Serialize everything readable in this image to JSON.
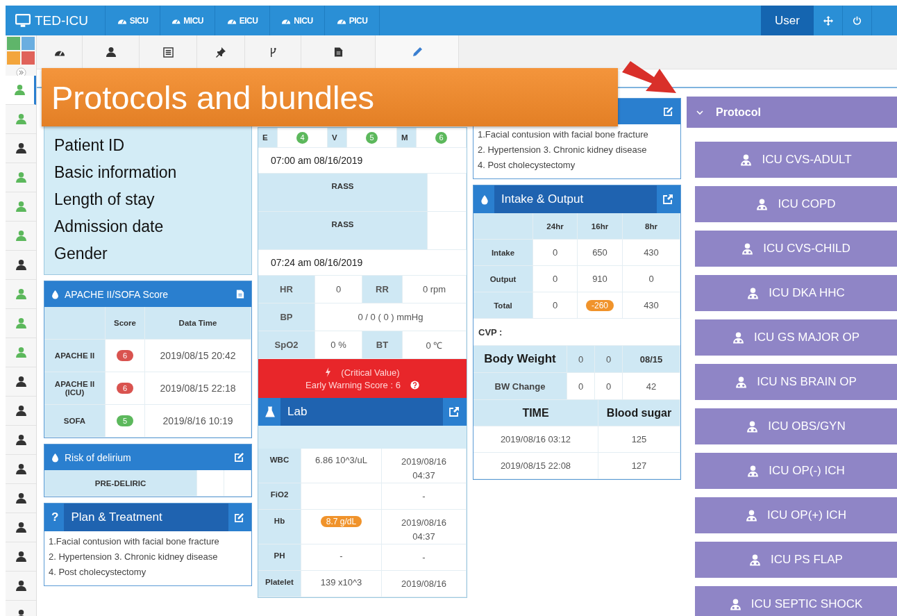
{
  "app": {
    "title": "TED-ICU"
  },
  "units": [
    "SICU",
    "MICU",
    "EICU",
    "NICU",
    "PICU"
  ],
  "user_menu": {
    "label": "User"
  },
  "patients": [
    {
      "color": "#5cb85c",
      "selected": true
    },
    {
      "color": "#5cb85c",
      "selected": false
    },
    {
      "color": "#333333",
      "selected": false
    },
    {
      "color": "#5cb85c",
      "selected": false
    },
    {
      "color": "#5cb85c",
      "selected": false
    },
    {
      "color": "#5cb85c",
      "selected": false
    },
    {
      "color": "#333333",
      "selected": false
    },
    {
      "color": "#5cb85c",
      "selected": false
    },
    {
      "color": "#5cb85c",
      "selected": false
    },
    {
      "color": "#5cb85c",
      "selected": false
    },
    {
      "color": "#333333",
      "selected": false
    },
    {
      "color": "#333333",
      "selected": false
    },
    {
      "color": "#333333",
      "selected": false
    },
    {
      "color": "#333333",
      "selected": false
    },
    {
      "color": "#333333",
      "selected": false
    },
    {
      "color": "#333333",
      "selected": false
    },
    {
      "color": "#333333",
      "selected": false
    },
    {
      "color": "#333333",
      "selected": false
    },
    {
      "color": "#333333",
      "selected": false
    }
  ],
  "banner": {
    "title": "Protocols and bundles"
  },
  "patient_info": {
    "lines": [
      "Patient ID",
      "Basic information",
      "Length of stay",
      "Admission date",
      "Gender"
    ]
  },
  "apache": {
    "title": "APACHE II/SOFA Score",
    "columns": [
      "Score",
      "Data Time"
    ],
    "rows": [
      {
        "name": "APACHE II",
        "score": "6",
        "color": "#d9534f",
        "time": "2019/08/15 20:42"
      },
      {
        "name": "APACHE II (ICU)",
        "score": "6",
        "color": "#d9534f",
        "time": "2019/08/15 22:18"
      },
      {
        "name": "SOFA",
        "score": "5",
        "color": "#5cb85c",
        "time": "2019/8/16 10:19"
      }
    ]
  },
  "delirium": {
    "title": "Risk of delirium",
    "value": "PRE-DELIRIC"
  },
  "plan": {
    "icon": "?",
    "title": "Plan & Treatment",
    "lines": [
      "1.Facial contusion with facial bone fracture",
      "2. Hypertension 3. Chronic kidney disease",
      "4. Post cholecystectomy"
    ]
  },
  "gcs": [
    {
      "label": "E",
      "score": "4"
    },
    {
      "label": "V",
      "score": "5"
    },
    {
      "label": "M",
      "score": "6"
    }
  ],
  "rass": {
    "time": "07:00 am 08/16/2019",
    "rows": [
      "RASS",
      "RASS"
    ]
  },
  "vitals": {
    "time": "07:24 am 08/16/2019",
    "items": [
      {
        "label": "HR",
        "value": "0",
        "wide": false
      },
      {
        "label": "RR",
        "value": "0 rpm",
        "wide": false
      },
      {
        "label": "BP",
        "value": "0 / 0 ( 0 ) mmHg",
        "wide": true
      },
      {
        "label": "SpO2",
        "value": "0 %",
        "wide": false
      },
      {
        "label": "BT",
        "value": "0 ℃",
        "wide": false
      }
    ]
  },
  "warning": {
    "title": "(Critical Value)",
    "text": "Early Warning Score : 6"
  },
  "lab": {
    "title": "Lab",
    "rows": [
      {
        "name": "WBC",
        "value": "6.86 10^3/uL",
        "abnormal": false,
        "time": "2019/08/16 04:37"
      },
      {
        "name": "FiO2",
        "time": "-"
      },
      {
        "name": "Hb",
        "value": "8.7 g/dL",
        "abnormal": true,
        "time": "2019/08/16 04:37"
      },
      {
        "name": "PH",
        "value": "-",
        "abnormal": false,
        "time": "-"
      },
      {
        "name": "Platelet",
        "value": "139 x10^3",
        "abnormal": false,
        "time": "2019/08/16"
      }
    ]
  },
  "diagnosis": {
    "lines": [
      "1.Facial contusion with facial bone fracture",
      "2. Hypertension 3. Chronic kidney disease",
      "4. Post cholecystectomy"
    ]
  },
  "io": {
    "title": "Intake & Output",
    "columns": [
      "24hr",
      "16hr",
      "8hr"
    ],
    "rows": [
      {
        "name": "Intake",
        "values": [
          {
            "text": "0",
            "abnormal": false
          },
          {
            "text": "650",
            "abnormal": false
          },
          {
            "text": "430",
            "abnormal": false
          }
        ]
      },
      {
        "name": "Output",
        "values": [
          {
            "text": "0",
            "abnormal": false
          },
          {
            "text": "910",
            "abnormal": false
          },
          {
            "text": "0",
            "abnormal": false
          }
        ]
      },
      {
        "name": "Total",
        "values": [
          {
            "text": "0",
            "abnormal": false
          },
          {
            "text": "-260",
            "abnormal": true
          },
          {
            "text": "430",
            "abnormal": false
          }
        ]
      }
    ]
  },
  "cvp": {
    "label": "CVP :"
  },
  "weight": [
    {
      "kind": "weight",
      "label": "Body Weight",
      "values": [
        "0",
        "0",
        "08/15"
      ]
    },
    {
      "kind": "change",
      "label": "BW Change",
      "values": [
        "0",
        "0",
        "42"
      ]
    }
  ],
  "blood_sugar": {
    "columns": [
      "TIME",
      "Blood sugar"
    ],
    "rows": [
      {
        "time": "2019/08/16 03:12",
        "value": "125"
      },
      {
        "time": "2019/08/15 22:08",
        "value": "127"
      }
    ]
  },
  "protocol": {
    "title": "Protocol",
    "expanded": true,
    "items": [
      "ICU CVS-ADULT",
      "ICU COPD",
      "ICU CVS-CHILD",
      "ICU DKA HHC",
      "ICU GS MAJOR OP",
      "ICU NS BRAIN OP",
      "ICU OBS/GYN",
      "ICU OP(-) ICH",
      "ICU OP(+) ICH",
      "ICU PS FLAP",
      "ICU SEPTIC SHOCK"
    ]
  }
}
